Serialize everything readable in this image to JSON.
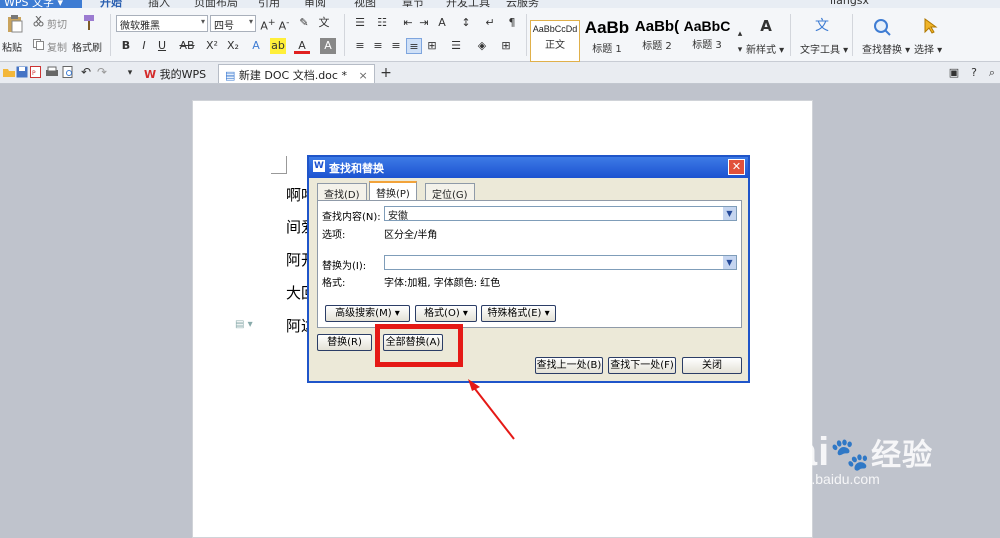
{
  "app": {
    "name": "WPS 文字"
  },
  "ribbon_tabs": [
    "开始",
    "插入",
    "页面布局",
    "引用",
    "审阅",
    "视图",
    "章节",
    "开发工具",
    "云服务"
  ],
  "ribbon_tab_active": "开始",
  "user": {
    "name": "liangsx"
  },
  "clipboard": {
    "paste": "粘贴",
    "cut": "剪切",
    "copy": "复制",
    "format_painter": "格式刷"
  },
  "font": {
    "family": "微软雅黑",
    "size": "四号"
  },
  "styles": [
    {
      "preview": "AaBbCcDd",
      "label": "正文"
    },
    {
      "preview": "AaBb",
      "label": "标题 1"
    },
    {
      "preview": "AaBb(",
      "label": "标题 2"
    },
    {
      "preview": "AaBbC",
      "label": "标题 3"
    }
  ],
  "tools": {
    "new_style": "新样式",
    "text_tools": "文字工具",
    "find_replace": "查找替换",
    "select": "选择"
  },
  "doc_tabs": [
    {
      "label": "我的WPS",
      "close": "×"
    },
    {
      "label": "新建 DOC 文档.doc *",
      "close": "×"
    }
  ],
  "add_tab": "+",
  "document": {
    "paragraphs": [
      "啊咯",
      "间爱",
      "阿开",
      "大回",
      "阿达"
    ]
  },
  "dialog": {
    "title": "查找和替换",
    "close": "✕",
    "tabs": [
      "查找(D)",
      "替换(P)",
      "定位(G)"
    ],
    "active_tab": "替换(P)",
    "find_label": "查找内容(N):",
    "find_value": "安徽",
    "find_options_label": "选项:",
    "find_options_value": "区分全/半角",
    "replace_label": "替换为(I):",
    "replace_value": "",
    "format_label": "格式:",
    "format_value": "字体:加粗, 字体颜色: 红色",
    "advanced_button": "高级搜索(M) ▾",
    "format_button": "格式(O) ▾",
    "special_button": "特殊格式(E) ▾",
    "replace_button": "替换(R)",
    "replace_all_button": "全部替换(A)",
    "find_prev_button": "查找上一处(B)",
    "find_next_button": "查找下一处(F)",
    "close_button": "关闭"
  },
  "watermark": {
    "brand": "Bai",
    "brand_cn": "经验",
    "url": "jingyan.baidu.com"
  },
  "colors": {
    "accent": "#3e7cd3",
    "dialog_title": "#1c52d0",
    "highlight": "#e51916"
  }
}
